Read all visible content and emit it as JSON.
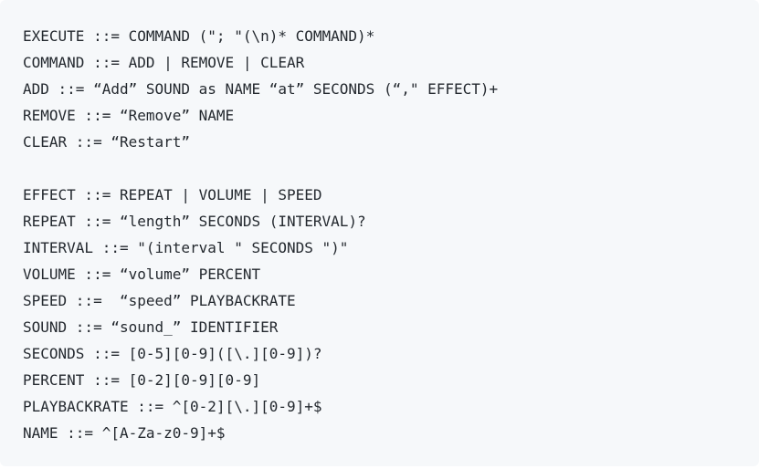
{
  "code": {
    "lines": [
      "EXECUTE ::= COMMAND (\"; \"(\\n)* COMMAND)*",
      "COMMAND ::= ADD | REMOVE | CLEAR",
      "ADD ::= “Add” SOUND as NAME “at” SECONDS (“,\" EFFECT)+",
      "REMOVE ::= “Remove” NAME",
      "CLEAR ::= “Restart”",
      "",
      "EFFECT ::= REPEAT | VOLUME | SPEED",
      "REPEAT ::= “length” SECONDS (INTERVAL)?",
      "INTERVAL ::= \"(interval \" SECONDS \")\"",
      "VOLUME ::= “volume” PERCENT",
      "SPEED ::=  “speed” PLAYBACKRATE",
      "SOUND ::= “sound_” IDENTIFIER",
      "SECONDS ::= [0-5][0-9]([\\.][0-9])?",
      "PERCENT ::= [0-2][0-9][0-9]",
      "PLAYBACKRATE ::= ^[0-2][\\.][0-9]+$",
      "NAME ::= ^[A-Za-z0-9]+$"
    ]
  }
}
